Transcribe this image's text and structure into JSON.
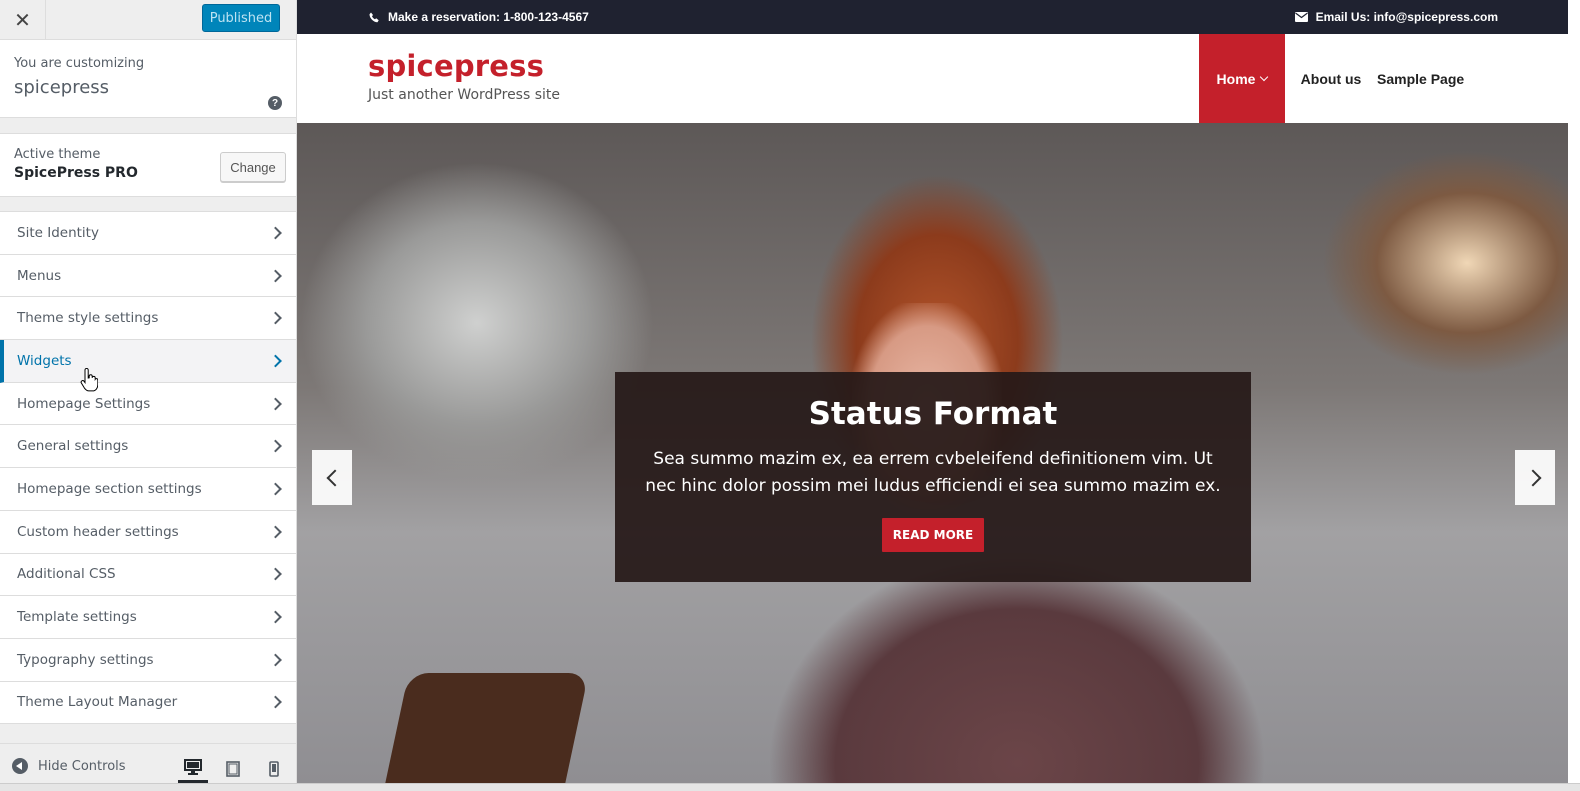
{
  "customizer": {
    "close_label": "✕",
    "publish_label": "Published",
    "customizing_label": "You are customizing",
    "site_name": "spicepress",
    "help_label": "?",
    "active_theme_label": "Active theme",
    "active_theme_name": "SpicePress PRO",
    "change_label": "Change",
    "panels": [
      {
        "label": "Site Identity",
        "active": false
      },
      {
        "label": "Menus",
        "active": false
      },
      {
        "label": "Theme style settings",
        "active": false
      },
      {
        "label": "Widgets",
        "active": true
      },
      {
        "label": "Homepage Settings",
        "active": false
      },
      {
        "label": "General settings",
        "active": false
      },
      {
        "label": "Homepage section settings",
        "active": false
      },
      {
        "label": "Custom header settings",
        "active": false
      },
      {
        "label": "Additional CSS",
        "active": false
      },
      {
        "label": "Template settings",
        "active": false
      },
      {
        "label": "Typography settings",
        "active": false
      },
      {
        "label": "Theme Layout Manager",
        "active": false
      }
    ],
    "hide_controls_label": "Hide Controls",
    "devices": [
      "desktop",
      "tablet",
      "mobile"
    ],
    "selected_device": "desktop"
  },
  "site": {
    "phone_text": "Make a reservation: 1-800-123-4567",
    "email_text": "Email Us: info@spicepress.com",
    "title": "spicepress",
    "tagline": "Just another WordPress site",
    "nav": [
      "Home",
      "About us",
      "Sample Page"
    ],
    "slider": {
      "title": "Status Format",
      "text": "Sea summo mazim ex, ea errem cvbeleifend definitionem vim. Ut nec hinc dolor possim mei ludus efficiendi ei sea summo mazim ex.",
      "button": "READ MORE"
    }
  },
  "colors": {
    "accent_blue": "#0073aa",
    "publish_blue": "#0085ba",
    "brand_red": "#c4202b",
    "topbar_bg": "#1f2230"
  }
}
